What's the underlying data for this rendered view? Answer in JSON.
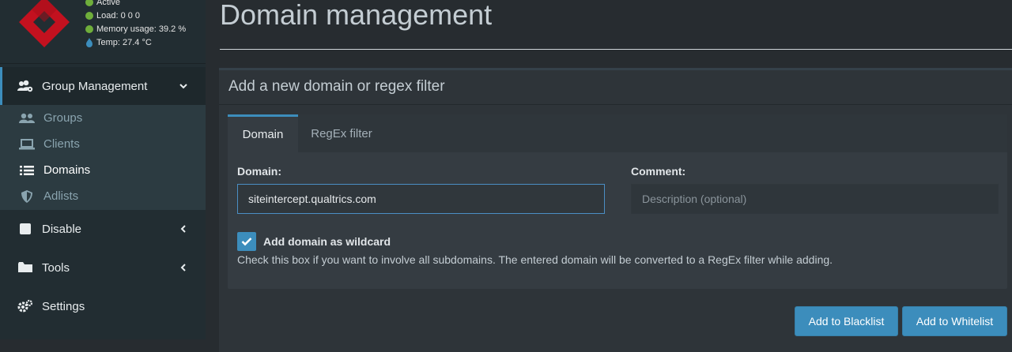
{
  "status": {
    "active": "Active",
    "load": "Load:  0  0  0",
    "memory": "Memory usage:  39.2 %",
    "temp": "Temp: 27.4 °C"
  },
  "sidebar": {
    "group_management": "Group Management",
    "sub_items": [
      "Groups",
      "Clients",
      "Domains",
      "Adlists"
    ],
    "disable": "Disable",
    "tools": "Tools",
    "settings": "Settings"
  },
  "page": {
    "title": "Domain management",
    "box_title": "Add a new domain or regex filter"
  },
  "tabs": [
    "Domain",
    "RegEx filter"
  ],
  "form": {
    "domain_label": "Domain:",
    "domain_value": "siteintercept.qualtrics.com",
    "comment_label": "Comment:",
    "comment_placeholder": "Description (optional)",
    "wildcard_label": "Add domain as wildcard",
    "wildcard_checked": true,
    "help_text": "Check this box if you want to involve all subdomains. The entered domain will be converted to a RegEx filter while adding."
  },
  "buttons": {
    "blacklist": "Add to Blacklist",
    "whitelist": "Add to Whitelist"
  },
  "colors": {
    "accent": "#3c8dbc",
    "status_green": "#6fae3b",
    "logo_red": "#c3111f"
  }
}
